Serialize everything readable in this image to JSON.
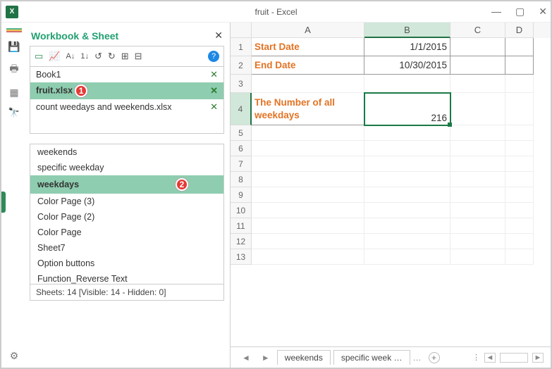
{
  "window": {
    "title": "fruit - Excel",
    "app_badge": "X"
  },
  "pane": {
    "title": "Workbook & Sheet"
  },
  "workbooks": [
    {
      "name": "Book1",
      "selected": false
    },
    {
      "name": "fruit.xlsx",
      "selected": true,
      "marker": "1"
    },
    {
      "name": "count weedays and weekends.xlsx",
      "selected": false
    }
  ],
  "sheets": [
    {
      "name": "weekends",
      "selected": false
    },
    {
      "name": "specific weekday",
      "selected": false
    },
    {
      "name": "weekdays",
      "selected": true,
      "marker": "2"
    },
    {
      "name": "Color Page (3)",
      "selected": false
    },
    {
      "name": "Color Page (2)",
      "selected": false
    },
    {
      "name": "Color Page",
      "selected": false
    },
    {
      "name": "Sheet7",
      "selected": false
    },
    {
      "name": "Option buttons",
      "selected": false
    },
    {
      "name": "Function_Reverse Text",
      "selected": false
    }
  ],
  "sheet_status": "Sheets: 14  [Visible: 14 - Hidden: 0]",
  "columns": [
    "A",
    "B",
    "C",
    "D"
  ],
  "rows": {
    "r1_label": "1",
    "r2_label": "2",
    "r3_label": "3",
    "r4_label": "4",
    "r5_label": "5",
    "r6_label": "6",
    "r7_label": "7",
    "r8_label": "8",
    "r9_label": "9",
    "r10_label": "10",
    "r11_label": "11",
    "r12_label": "12",
    "r13_label": "13"
  },
  "cells": {
    "A1": "Start Date",
    "B1": "1/1/2015",
    "A2": "End Date",
    "B2": "10/30/2015",
    "A4": "The Number of all weekdays",
    "B4": "216"
  },
  "footer": {
    "tab1": "weekends",
    "tab2": "specific week …",
    "plus": "+"
  },
  "chart_data": null
}
